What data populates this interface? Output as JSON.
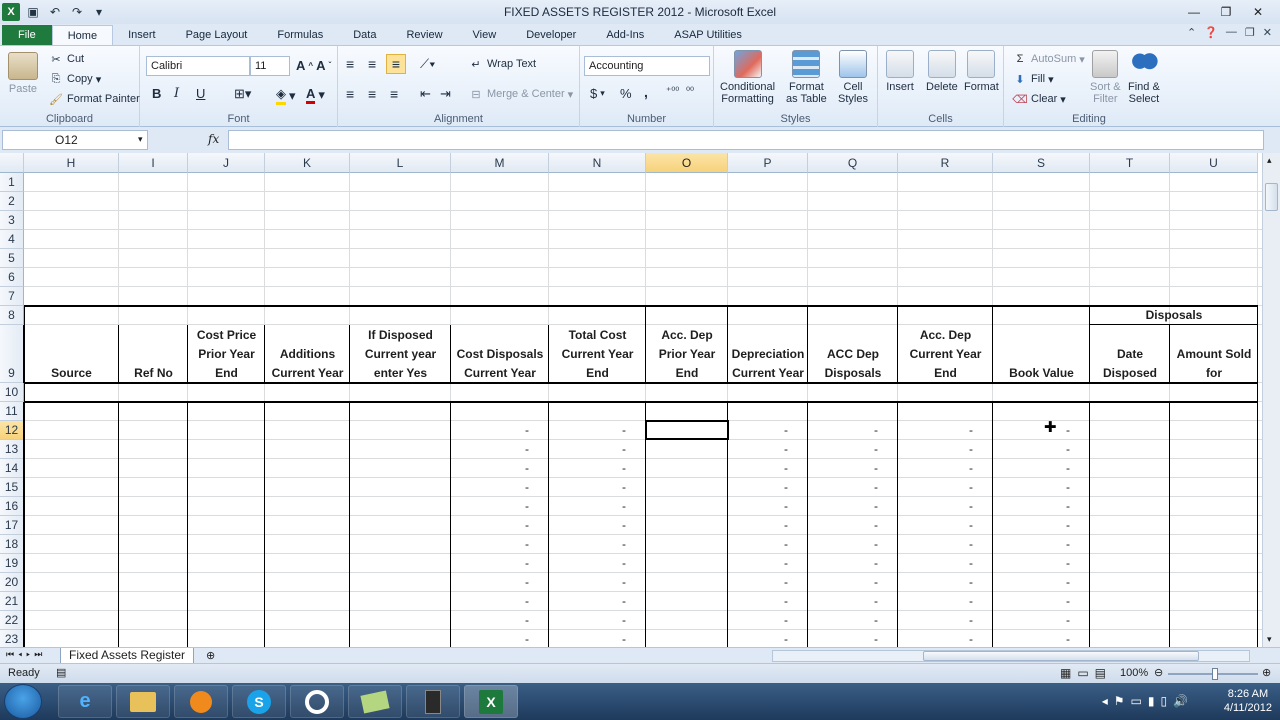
{
  "app": {
    "title": "FIXED ASSETS REGISTER 2012  -  Microsoft Excel",
    "icon": "excel-icon"
  },
  "tabs": [
    "File",
    "Home",
    "Insert",
    "Page Layout",
    "Formulas",
    "Data",
    "Review",
    "View",
    "Developer",
    "Add-Ins",
    "ASAP Utilities"
  ],
  "ribbon": {
    "clipboard": {
      "paste": "Paste",
      "cut": "Cut",
      "copy": "Copy",
      "format_painter": "Format Painter",
      "label": "Clipboard"
    },
    "font": {
      "name": "Calibri",
      "size": "11",
      "label": "Font",
      "bold": "B",
      "italic": "I",
      "underline": "U"
    },
    "alignment": {
      "wrap_text": "Wrap Text",
      "merge_center": "Merge & Center",
      "label": "Alignment"
    },
    "number": {
      "format": "Accounting",
      "currency": "$",
      "percent": "%",
      "comma": ",",
      "label": "Number"
    },
    "styles": {
      "conditional": "Conditional\nFormatting",
      "format_table": "Format\nas Table",
      "cell_styles": "Cell\nStyles",
      "label": "Styles"
    },
    "cells": {
      "insert": "Insert",
      "delete": "Delete",
      "format": "Format",
      "label": "Cells"
    },
    "editing": {
      "autosum": "AutoSum",
      "fill": "Fill",
      "clear": "Clear",
      "sort_filter": "Sort &\nFilter",
      "find_select": "Find &\nSelect",
      "label": "Editing"
    }
  },
  "formula_bar": {
    "name_box": "O12",
    "fx": "fx",
    "value": ""
  },
  "sheet": {
    "columns": [
      "H",
      "I",
      "J",
      "K",
      "L",
      "M",
      "N",
      "O",
      "P",
      "Q",
      "R",
      "S",
      "T",
      "U"
    ],
    "selected_column": "O",
    "rows": [
      "1",
      "2",
      "3",
      "4",
      "5",
      "6",
      "7",
      "8",
      "9",
      "10",
      "11",
      "12",
      "13",
      "14",
      "15",
      "16",
      "17",
      "18",
      "19",
      "20",
      "21",
      "22",
      "23"
    ],
    "selected_row": "12",
    "active_cell": "O12",
    "disposals_header": "Disposals",
    "headers": {
      "H": "Source",
      "I": "Ref No",
      "J": "Cost Price\nPrior Year\nEnd",
      "K": "Additions\nCurrent Year",
      "L": "If Disposed\nCurrent year\nenter Yes",
      "M": "Cost Disposals\nCurrent Year",
      "N": "Total Cost\nCurrent Year\nEnd",
      "O": "Acc. Dep\nPrior Year\nEnd",
      "P": "Depreciation\nCurrent Year",
      "Q": "ACC Dep\nDisposals",
      "R": "Acc. Dep\nCurrent Year\nEnd",
      "S": "Book Value",
      "T": "Date\nDisposed",
      "U": "Amount Sold\nfor"
    },
    "dash_value": "-",
    "dash_columns": [
      "M",
      "N",
      "P",
      "Q",
      "R",
      "S"
    ],
    "dash_rows": [
      "12",
      "13",
      "14",
      "15",
      "16",
      "17",
      "18",
      "19",
      "20",
      "21",
      "22",
      "23"
    ]
  },
  "sheet_tab": "Fixed Assets Register",
  "status": {
    "ready": "Ready",
    "zoom": "100%"
  },
  "clock": {
    "time": "8:26 AM",
    "date": "4/11/2012"
  }
}
